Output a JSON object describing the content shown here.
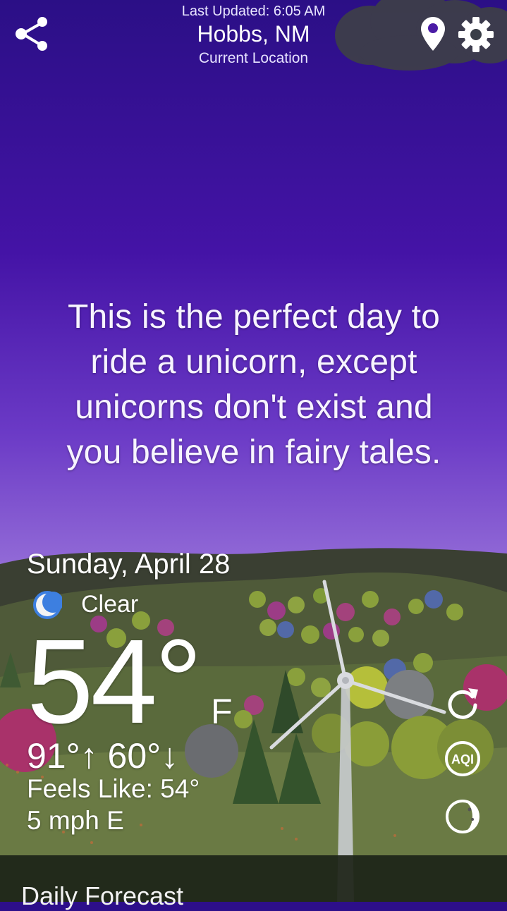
{
  "header": {
    "last_updated": "Last Updated: 6:05 AM",
    "city": "Hobbs, NM",
    "location_label": "Current Location"
  },
  "icons": {
    "share": "share-icon",
    "location": "map-pin-icon",
    "settings": "gear-icon",
    "moon": "crescent-moon-icon",
    "refresh": "refresh-icon",
    "aqi": "aqi-icon",
    "moon_phase": "moon-phase-icon"
  },
  "quote": {
    "line1": "This is the perfect day to",
    "line2": "ride a unicorn, except",
    "line3": "unicorns don't exist and",
    "line4": "you believe in fairy tales."
  },
  "weather": {
    "date": "Sunday, April 28",
    "condition": "Clear",
    "temperature": "54°",
    "unit": "F",
    "high": "91°",
    "low": "60°",
    "feels_like": "Feels Like: 54°",
    "wind": "5 mph E"
  },
  "aqi_label": "AQI",
  "footer": {
    "daily_forecast": "Daily Forecast"
  },
  "colors": {
    "sky_top": "#2b0f86",
    "sky_bottom": "#d6c5f3",
    "hills": "#4f5a39"
  }
}
